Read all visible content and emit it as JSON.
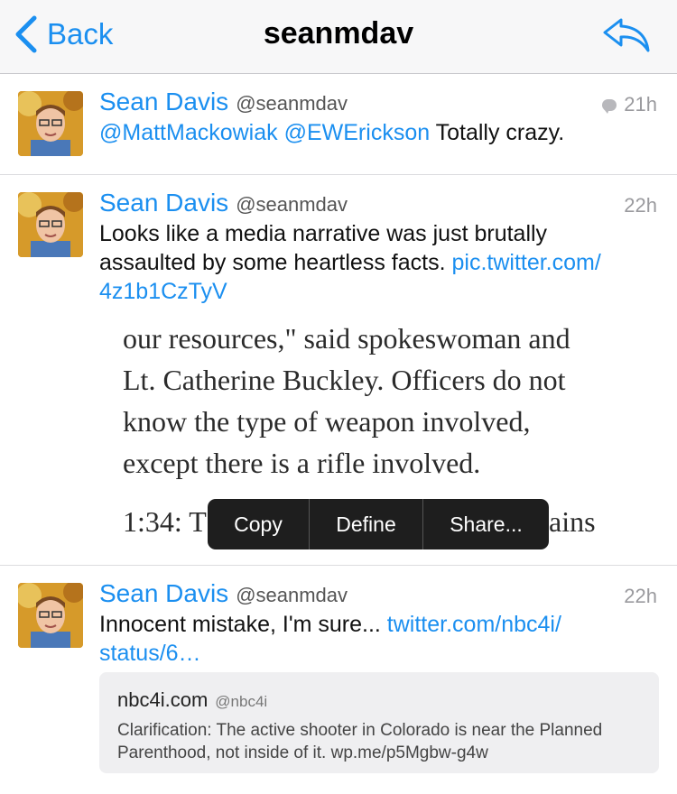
{
  "nav": {
    "back_label": "Back",
    "title": "seanmdav"
  },
  "tweets": [
    {
      "name": "Sean Davis",
      "handle": "@seanmdav",
      "time": "21h",
      "has_reply_icon": true,
      "text_parts": [
        {
          "text": "@MattMackowiak",
          "link": true
        },
        {
          "text": " ",
          "link": false
        },
        {
          "text": "@EWErickson",
          "link": true
        },
        {
          "text": " Totally crazy.",
          "link": false
        }
      ]
    },
    {
      "name": "Sean Davis",
      "handle": "@seanmdav",
      "time": "22h",
      "text_line1": "Looks like a media narrative was just brutally",
      "text_line2": "assaulted by some heartless facts.",
      "text_link_line2": "pic.twitter.com/",
      "text_link_line3": "4z1b1CzTyV",
      "photo": {
        "line1": "our resources,\" said spokeswoman and",
        "line2": "Lt. Catherine Buckley. Officers do not",
        "line3": "know the type of weapon involved,",
        "line4": "except there is a rifle involved.",
        "line5_left": "1:34: T",
        "line5_right": "ains"
      }
    },
    {
      "name": "Sean Davis",
      "handle": "@seanmdav",
      "time": "22h",
      "text_line1": "Innocent mistake, I'm sure...",
      "text_link_line1": "twitter.com/nbc4i/",
      "text_link_line2": "status/6…",
      "card": {
        "name": "nbc4i.com",
        "handle": "@nbc4i",
        "text": "Clarification: The active shooter in Colorado is near the Planned Parenthood, not inside of it. wp.me/p5Mgbw-g4w"
      }
    }
  ],
  "callout_menu": {
    "items": [
      "Copy",
      "Define",
      "Share..."
    ]
  },
  "colors": {
    "link": "#1b8ff0",
    "nav_bg": "#f7f7f8",
    "callout_bg": "#1e1e1e"
  }
}
